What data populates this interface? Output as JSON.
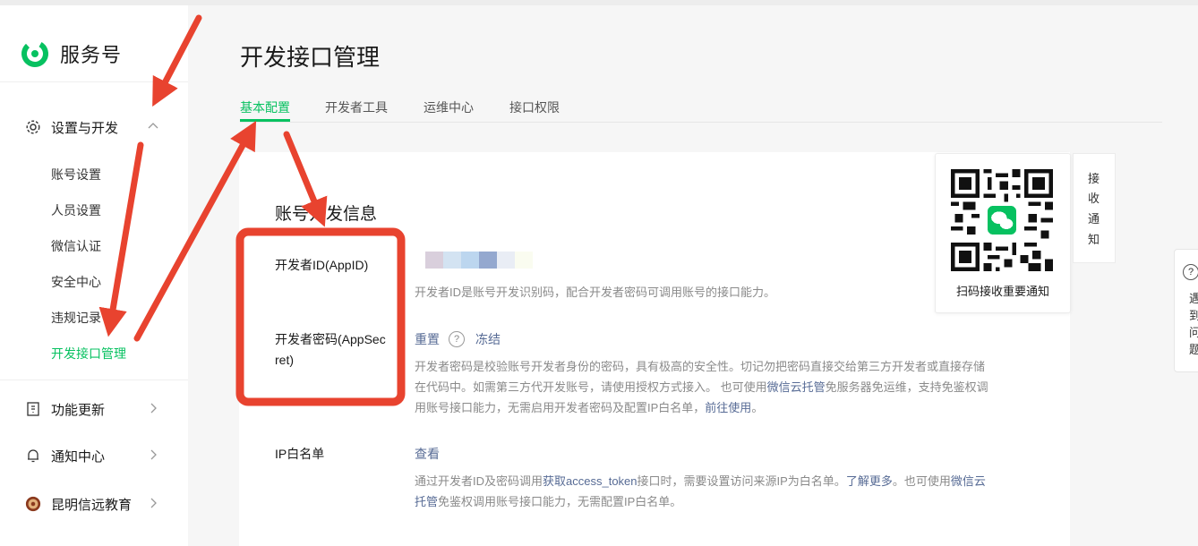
{
  "brand": {
    "name": "服务号",
    "color": "#07c160"
  },
  "sidebar": {
    "groups": [
      {
        "label": "设置与开发",
        "icon": "gear-icon",
        "expanded": true
      },
      {
        "label": "功能更新",
        "icon": "update-icon"
      },
      {
        "label": "通知中心",
        "icon": "bell-icon"
      },
      {
        "label": "昆明信远教育",
        "icon": "avatar-icon"
      }
    ],
    "sub_items": [
      "账号设置",
      "人员设置",
      "微信认证",
      "安全中心",
      "违规记录",
      "开发接口管理"
    ],
    "active_sub": "开发接口管理"
  },
  "page": {
    "title": "开发接口管理",
    "tabs": [
      "基本配置",
      "开发者工具",
      "运维中心",
      "接口权限"
    ],
    "active_tab": "基本配置"
  },
  "section": {
    "title": "账号开发信息",
    "appid": {
      "label": "开发者ID(AppID)",
      "desc": "开发者ID是账号开发识别码，配合开发者密码可调用账号的接口能力。"
    },
    "secret": {
      "label_line1": "开发者密码(AppSec",
      "label_line2": "ret)",
      "reset": "重置",
      "help": "?",
      "freeze": "冻结",
      "desc_line1": "开发者密码是校验账号开发者身份的密码，具有极高的安全性。切记勿把密码直接交给第三方开发者或直接存储",
      "desc_line2_a": "在代码中。如需第三方代开发账号，请使用授权方式接入。 也可使用",
      "desc_line2_link": "微信云托管",
      "desc_line2_b": "免服务器免运维，支持免鉴权调",
      "desc_line3_a": "用账号接口能力，无需启用开发者密码及配置IP白名单，",
      "desc_line3_link": "前往使用",
      "desc_line3_b": "。"
    },
    "ip": {
      "label": "IP白名单",
      "view": "查看",
      "desc_line1_a": "通过开发者ID及密码调用",
      "desc_line1_link1": "获取access_token",
      "desc_line1_b": "接口时，需要设置访问来源IP为白名单。",
      "desc_line1_link2": "了解更多",
      "desc_line1_c": "。也可使用",
      "desc_line1_link3": "微信云",
      "desc_line2_link": "托管",
      "desc_line2_b": "免鉴权调用账号接口能力，无需配置IP白名单。"
    }
  },
  "qr_panel": {
    "caption": "扫码接收重要通知",
    "icon": "qr-code-icon"
  },
  "receive_tab": [
    "接",
    "收",
    "通",
    "知"
  ],
  "help_tab": {
    "icon": "question-icon",
    "chars": [
      "遇",
      "到",
      "问",
      "题"
    ]
  },
  "annotation_color": "#e8432f"
}
